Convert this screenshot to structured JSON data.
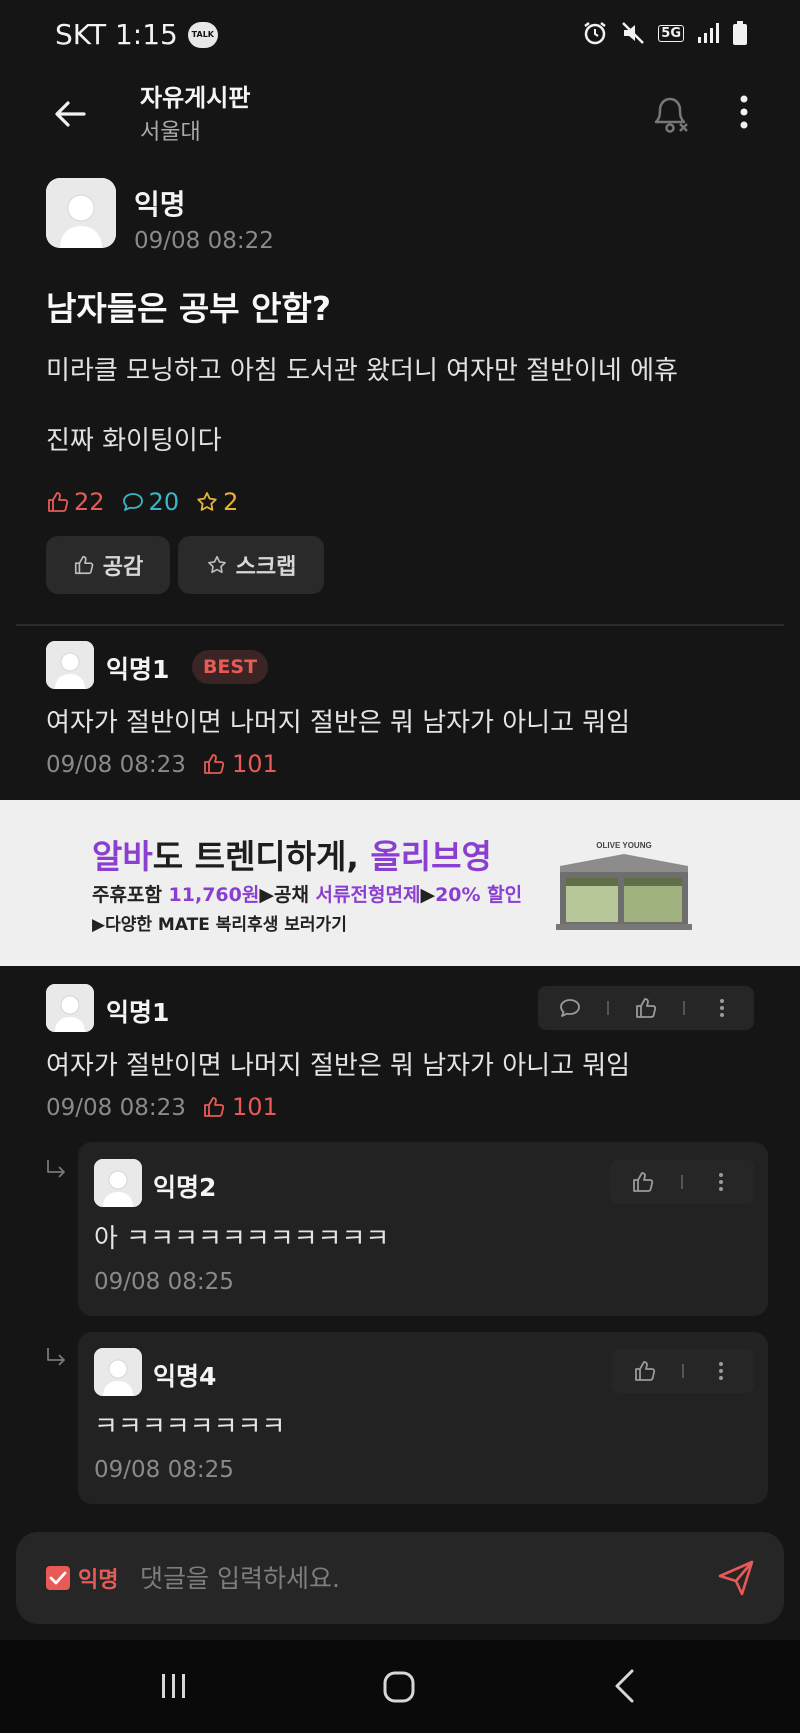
{
  "status_bar": {
    "carrier_time": "SKT 1:15",
    "talk_badge": "TALK",
    "network": "5G"
  },
  "header": {
    "title": "자유게시판",
    "subtitle": "서울대"
  },
  "post": {
    "author": "익명",
    "time": "09/08 08:22",
    "title": "남자들은 공부 안함?",
    "body_line1": "미라클 모닝하고 아침 도서관 왔더니 여자만 절반이네 에휴",
    "body_line2": "진짜 화이팅이다",
    "likes": "22",
    "comments": "20",
    "scraps": "2",
    "like_button": "공감",
    "scrap_button": "스크랩"
  },
  "best_comment": {
    "author": "익명1",
    "badge": "BEST",
    "text": "여자가 절반이면 나머지 절반은 뭐 남자가 아니고 뭐임",
    "time": "09/08 08:23",
    "likes": "101"
  },
  "ad": {
    "head_hl1": "알바",
    "head_mid": "도 트렌디하게, ",
    "head_hl2": "올리브영",
    "line2_a": "주휴포함 ",
    "line2_hl1": "11,760원",
    "line2_b": "▶공채 ",
    "line2_hl2": "서류전형면제",
    "line2_c": "▶",
    "line2_hl3": "20% 할인",
    "line3": "▶다양한 MATE 복리후생 보러가기",
    "store_sign": "OLIVE YOUNG"
  },
  "comments": [
    {
      "author": "익명1",
      "text": "여자가 절반이면 나머지 절반은 뭐 남자가 아니고 뭐임",
      "time": "09/08 08:23",
      "likes": "101"
    }
  ],
  "replies": [
    {
      "author": "익명2",
      "text": "아 ㅋㅋㅋㅋㅋㅋㅋㅋㅋㅋㅋ",
      "time": "09/08 08:25"
    },
    {
      "author": "익명4",
      "text": "ㅋㅋㅋㅋㅋㅋㅋㅋ",
      "time": "09/08 08:25"
    }
  ],
  "input_bar": {
    "anon_label": "익명",
    "placeholder": "댓글을 입력하세요."
  },
  "colors": {
    "accent_red": "#e85a57",
    "comment_teal": "#3ab6c4",
    "scrap_yellow": "#e6b23c",
    "ad_purple": "#8a3fd1"
  }
}
